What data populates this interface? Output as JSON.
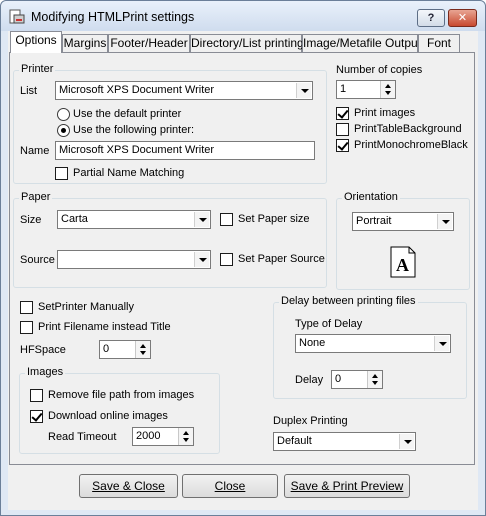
{
  "window": {
    "title": "Modifying HTMLPrint settings",
    "help_btn": "?",
    "close_btn": "✕"
  },
  "tabs": [
    "Options",
    "Margins",
    "Footer/Header",
    "Directory/List printing",
    "Image/Metafile Output",
    "Font"
  ],
  "printer": {
    "legend": "Printer",
    "list_label": "List",
    "list_value": "Microsoft XPS Document Writer",
    "radio_default": "Use the default printer",
    "radio_following": "Use the following printer:",
    "name_label": "Name",
    "name_value": "Microsoft XPS Document Writer",
    "partial_match": "Partial Name Matching"
  },
  "copies": {
    "label": "Number of copies",
    "value": "1",
    "print_images": "Print images",
    "print_table_bg": "PrintTableBackground",
    "print_mono": "PrintMonochromeBlack"
  },
  "paper": {
    "legend": "Paper",
    "size_label": "Size",
    "size_value": "Carta",
    "set_size": "Set Paper size",
    "source_label": "Source",
    "source_value": "",
    "set_source": "Set Paper Source"
  },
  "orientation": {
    "legend": "Orientation",
    "value": "Portrait",
    "icon_letter": "A"
  },
  "misc": {
    "set_printer_manually": "SetPrinter Manually",
    "print_filename": "Print Filename instead Title",
    "hfspace_label": "HFSpace",
    "hfspace_value": "0"
  },
  "images": {
    "legend": "Images",
    "remove_path": "Remove file path from images",
    "download_online": "Download online images",
    "read_timeout_label": "Read Timeout",
    "read_timeout_value": "2000"
  },
  "delay": {
    "legend": "Delay between printing files",
    "type_label": "Type of Delay",
    "type_value": "None",
    "delay_label": "Delay",
    "delay_value": "0"
  },
  "duplex": {
    "label": "Duplex Printing",
    "value": "Default"
  },
  "buttons": {
    "save_close": "Save & Close",
    "close": "Close",
    "save_preview": "Save & Print Preview"
  }
}
